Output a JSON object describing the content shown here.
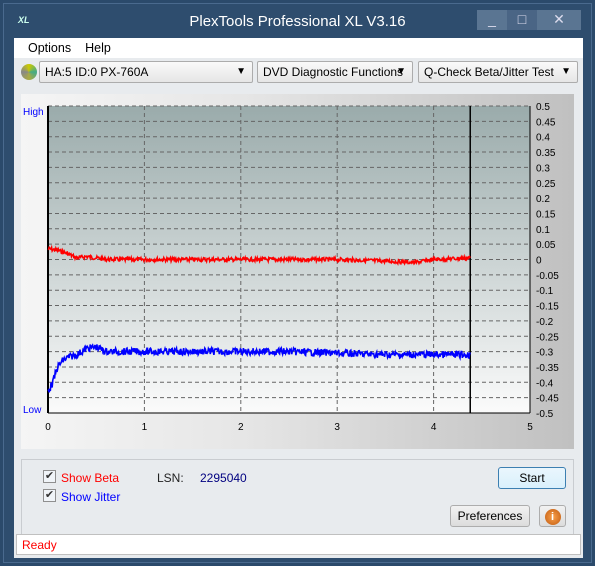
{
  "window": {
    "title": "PlexTools Professional XL V3.16",
    "logo": "XL"
  },
  "menu": [
    "Options",
    "Help"
  ],
  "toolbar": {
    "drive": "HA:5 ID:0  PX-760A",
    "function": "DVD Diagnostic Functions",
    "test": "Q-Check Beta/Jitter Test"
  },
  "chart_data": {
    "type": "line",
    "xlim": [
      0,
      5
    ],
    "ylim": [
      -0.5,
      0.5
    ],
    "x_ticks": [
      "0",
      "1",
      "2",
      "3",
      "4",
      "5"
    ],
    "y_ticks": [
      "0.5",
      "0.45",
      "0.4",
      "0.35",
      "0.3",
      "0.25",
      "0.2",
      "0.15",
      "0.1",
      "0.05",
      "0",
      "-0.05",
      "-0.1",
      "-0.15",
      "-0.2",
      "-0.25",
      "-0.3",
      "-0.35",
      "-0.4",
      "-0.45",
      "-0.5"
    ],
    "left_labels": {
      "high": "High",
      "low": "Low"
    },
    "grid": true,
    "end_marker_x": 4.38,
    "series": [
      {
        "key": "beta",
        "color": "#ff0000",
        "x": [
          0,
          0.1,
          0.2,
          0.3,
          0.4,
          0.5,
          0.6,
          1,
          1.5,
          2,
          2.5,
          3,
          3.5,
          3.8,
          4,
          4.38
        ],
        "y": [
          0.035,
          0.03,
          0.02,
          0.005,
          0.01,
          0.005,
          0.0,
          0.0,
          0.0,
          0.0,
          0.0,
          0.0,
          -0.005,
          -0.01,
          0.0,
          0.005
        ]
      },
      {
        "key": "jitter",
        "color": "#0000ff",
        "x": [
          0,
          0.05,
          0.1,
          0.15,
          0.2,
          0.3,
          0.4,
          0.5,
          0.6,
          1,
          1.5,
          2,
          2.5,
          3,
          3.5,
          4,
          4.38
        ],
        "y": [
          -0.43,
          -0.4,
          -0.35,
          -0.33,
          -0.32,
          -0.31,
          -0.29,
          -0.285,
          -0.3,
          -0.3,
          -0.3,
          -0.3,
          -0.3,
          -0.305,
          -0.31,
          -0.31,
          -0.31
        ]
      }
    ]
  },
  "controls": {
    "show_beta": "Show Beta",
    "show_jitter": "Show Jitter",
    "lsn_label": "LSN:",
    "lsn_value": "2295040",
    "start": "Start",
    "preferences": "Preferences"
  },
  "colors": {
    "beta": "#ff0000",
    "jitter": "#0000ff"
  },
  "status": "Ready"
}
